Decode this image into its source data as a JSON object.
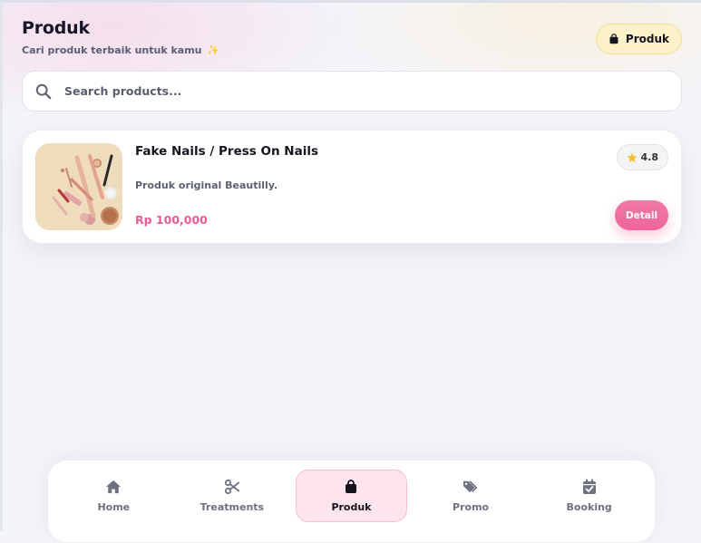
{
  "header": {
    "title": "Produk",
    "subtitle": "Cari produk terbaik untuk kamu",
    "subtitle_emoji": "✨",
    "badge_label": "Produk",
    "badge_icon": "shopping-bag-icon"
  },
  "search": {
    "placeholder": "Search products...",
    "value": "",
    "icon": "search-icon"
  },
  "products": [
    {
      "name": "Fake Nails / Press On Nails",
      "description": "Produk original Beautilly.",
      "price": "Rp 100,000",
      "rating": "4.8",
      "detail_label": "Detail",
      "image": "cosmetics-flatlay"
    }
  ],
  "nav": {
    "items": [
      {
        "label": "Home",
        "icon": "home-icon",
        "active": false
      },
      {
        "label": "Treatments",
        "icon": "scissors-icon",
        "active": false
      },
      {
        "label": "Produk",
        "icon": "shopping-bag-icon",
        "active": true
      },
      {
        "label": "Promo",
        "icon": "tags-icon",
        "active": false
      },
      {
        "label": "Booking",
        "icon": "calendar-check-icon",
        "active": false
      }
    ]
  },
  "colors": {
    "accent_pink": "#ec6596",
    "price_pink": "#ea5b93",
    "badge_yellow": "#fdf1c9",
    "star": "#f5c02b",
    "active_nav_bg": "#fde4ed"
  }
}
